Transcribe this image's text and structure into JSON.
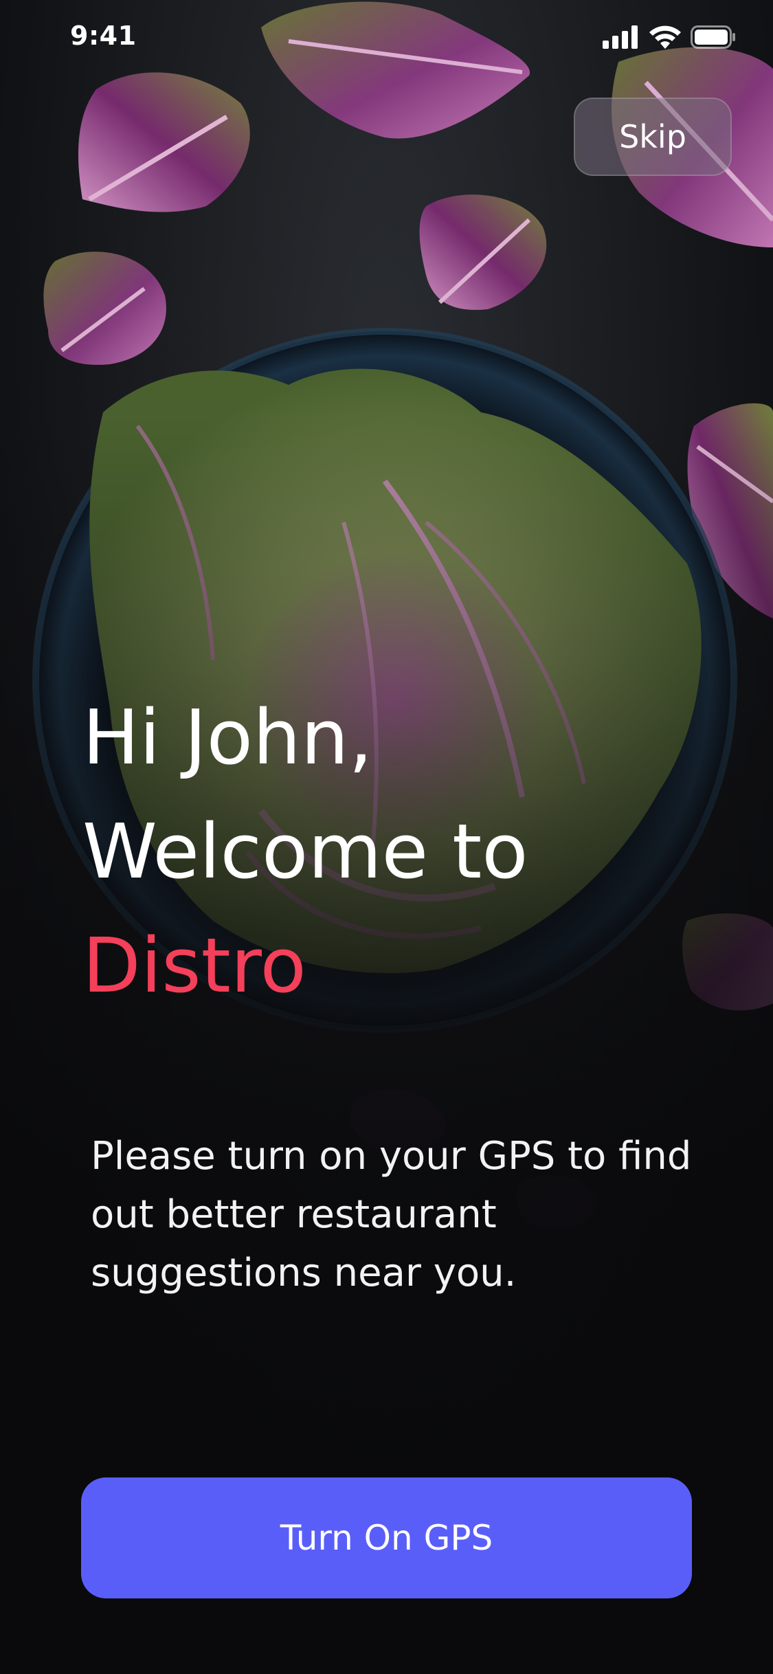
{
  "status_bar": {
    "time": "9:41",
    "icons": [
      "signal-icon",
      "wifi-icon",
      "battery-icon"
    ]
  },
  "header": {
    "skip_label": "Skip"
  },
  "welcome": {
    "greeting": "Hi John,",
    "welcome_line": "Welcome to",
    "brand": "Distro",
    "description": "Please turn on your GPS to find out better restaurant suggestions near you."
  },
  "actions": {
    "gps_label": "Turn On GPS"
  },
  "colors": {
    "brand": "#f4405a",
    "primary_button": "#5a5ef9",
    "background": "#0b0b0d"
  },
  "background_image": "cabbage-bowl-photo"
}
